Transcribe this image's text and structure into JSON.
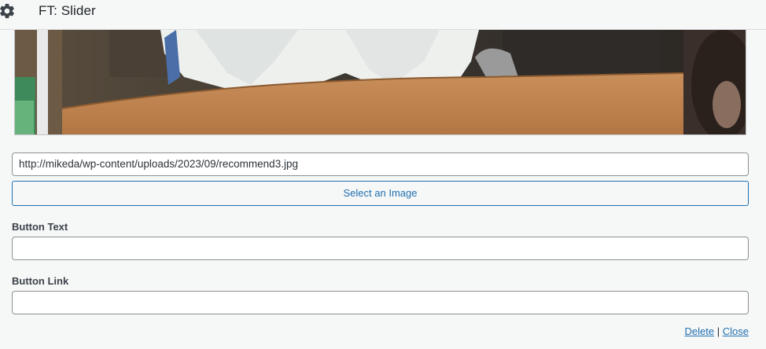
{
  "widget": {
    "title": "FT: Slider"
  },
  "image_preview": {
    "description_icon": "image-preview"
  },
  "image_field": {
    "url_value": "http://mikeda/wp-content/uploads/2023/09/recommend3.jpg",
    "select_label": "Select an Image"
  },
  "button_text_field": {
    "label": "Button Text",
    "value": ""
  },
  "button_link_field": {
    "label": "Button Link",
    "value": ""
  },
  "actions": {
    "delete_label": "Delete",
    "separator": "|",
    "close_label": "Close"
  },
  "colors": {
    "accent": "#2271b1",
    "panel_bg": "#f6f7f7",
    "border": "#8c8f94"
  }
}
